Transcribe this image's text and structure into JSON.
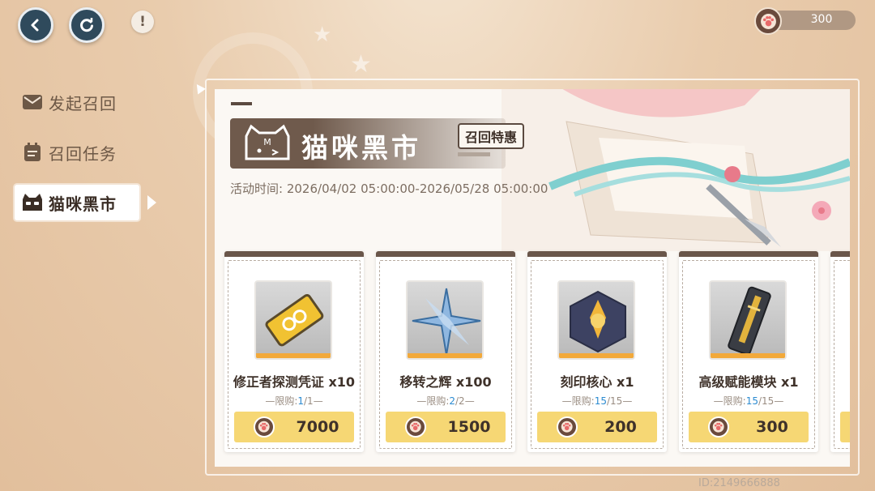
{
  "header": {
    "currency_amount": "300",
    "icons": {
      "back": "back-arrow-icon",
      "refresh": "refresh-icon",
      "info": "exclamation-icon",
      "currency": "paw-coin-icon"
    },
    "info_glyph": "!"
  },
  "sidebar": {
    "items": [
      {
        "label": "发起召回",
        "icon": "mail-icon",
        "active": false
      },
      {
        "label": "召回任务",
        "icon": "task-list-icon",
        "active": false
      },
      {
        "label": "猫咪黑市",
        "icon": "cat-face-icon",
        "active": true
      }
    ]
  },
  "banner": {
    "title": "猫咪黑市",
    "tag": "召回特惠",
    "time_label": "活动时间:",
    "time_range": "2026/04/02 05:00:00-2026/05/28 05:00:00"
  },
  "shop": {
    "limit_prefix": "—限购:",
    "limit_suffix": "—",
    "items": [
      {
        "name": "修正者探测凭证 x10",
        "limit_used": "1",
        "limit_total": "/1",
        "price": "7000",
        "icon": "gold-ticket-icon"
      },
      {
        "name": "移转之辉 x100",
        "limit_used": "2",
        "limit_total": "/2",
        "price": "1500",
        "icon": "blue-star-crystal-icon"
      },
      {
        "name": "刻印核心 x1",
        "limit_used": "15",
        "limit_total": "/15",
        "price": "200",
        "icon": "hexagon-core-icon"
      },
      {
        "name": "高级赋能模块 x1",
        "limit_used": "15",
        "limit_total": "/15",
        "price": "300",
        "icon": "module-card-icon"
      }
    ]
  },
  "footer": {
    "uid": "ID:2149666888"
  },
  "colors": {
    "accent_brown": "#6f5a4c",
    "buy_yellow": "#f6d774",
    "limit_blue": "#2c8bd1",
    "rarity_orange": "#f2a93a"
  }
}
